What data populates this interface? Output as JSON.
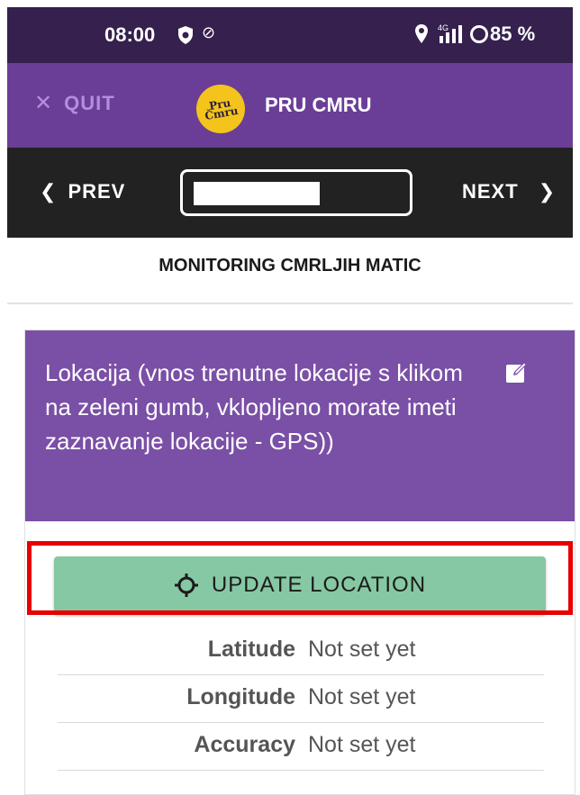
{
  "status_bar": {
    "time": "08:00",
    "network": "4G",
    "battery": "85 %",
    "icons": [
      "shield-icon",
      "sync-icon",
      "location-pin-icon",
      "signal-icon",
      "battery-ring-icon"
    ]
  },
  "app_bar": {
    "quit_label": "QUIT",
    "logo_text": "Pru Čmru",
    "title": "PRU CMRU",
    "colors": {
      "bar": "#6a3e96",
      "logo": "#f4c41d"
    }
  },
  "nav_bar": {
    "prev_label": "PREV",
    "next_label": "NEXT"
  },
  "section_title": "MONITORING CMRLJIH MATIC",
  "question": {
    "text": "Lokacija (vnos trenutne lokacije s klikom na zeleni gumb, vklopljeno morate imeti zaznavanje lokacije - GPS))",
    "header_color": "#7a4fa6"
  },
  "update_button": {
    "label": "UPDATE LOCATION",
    "color": "#86c8a3"
  },
  "fields": [
    {
      "label": "Latitude",
      "value": "Not set yet"
    },
    {
      "label": "Longitude",
      "value": "Not set yet"
    },
    {
      "label": "Accuracy",
      "value": "Not set yet"
    }
  ]
}
